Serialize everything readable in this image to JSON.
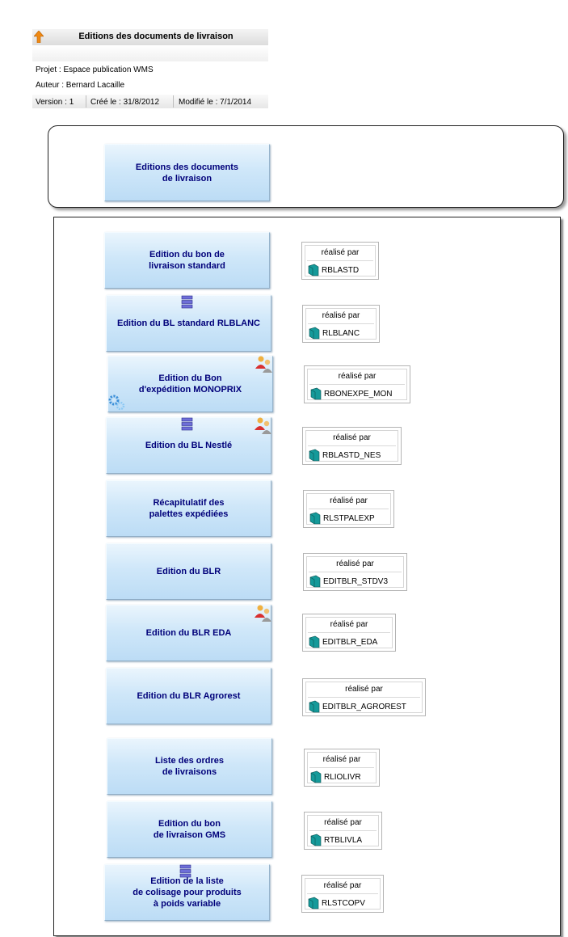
{
  "header": {
    "title": "Editions des documents de livraison",
    "projet": "Projet : Espace publication WMS",
    "auteur": "Auteur : Bernard Lacaille",
    "version": "Version : 1",
    "cree": "Créé le : 31/8/2012",
    "modifie": "Modifié le : 7/1/2014"
  },
  "top_process": {
    "label": "Editions des documents\nde livraison"
  },
  "rp_label": "réalisé par",
  "processes": [
    {
      "label": "Edition du bon de\nlivraison standard",
      "code": "RBLASTD"
    },
    {
      "label": "Edition du BL standard RLBLANC",
      "code": "RLBLANC"
    },
    {
      "label": "Edition du Bon\nd'expédition MONOPRIX",
      "code": "RBONEXPE_MON"
    },
    {
      "label": "Edition du BL Nestlé",
      "code": "RBLASTD_NES"
    },
    {
      "label": "Récapitulatif des\npalettes expédiées",
      "code": "RLSTPALEXP"
    },
    {
      "label": "Edition du BLR",
      "code": "EDITBLR_STDV3"
    },
    {
      "label": "Edition du BLR EDA",
      "code": "EDITBLR_EDA"
    },
    {
      "label": "Edition du BLR Agrorest",
      "code": "EDITBLR_AGROREST"
    },
    {
      "label": "Liste des ordres\nde livraisons",
      "code": "RLIOLIVR"
    },
    {
      "label": "Edition du bon\nde livraison GMS",
      "code": "RTBLIVLA"
    },
    {
      "label": "Edition de la liste\nde colisage pour produits\nà poids variable",
      "code": "RLSTCOPV"
    }
  ],
  "icons": {
    "up": "up-arrow-icon",
    "database": "database-icon",
    "people": "people-icon",
    "gear": "gear-icon",
    "book": "book-icon"
  }
}
